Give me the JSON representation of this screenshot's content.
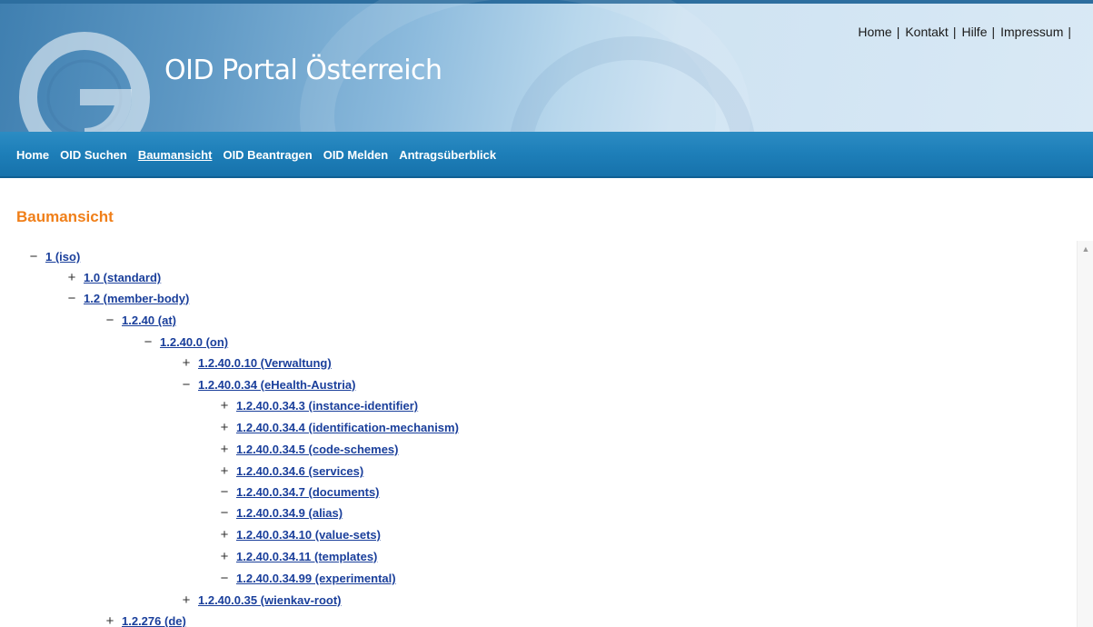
{
  "header": {
    "site_title": "OID Portal Österreich",
    "top_links": [
      {
        "label": "Home"
      },
      {
        "label": "Kontakt"
      },
      {
        "label": "Hilfe"
      },
      {
        "label": "Impressum"
      }
    ],
    "separator": "|"
  },
  "nav": {
    "items": [
      {
        "label": "Home",
        "active": false
      },
      {
        "label": "OID Suchen",
        "active": false
      },
      {
        "label": "Baumansicht",
        "active": true
      },
      {
        "label": "OID Beantragen",
        "active": false
      },
      {
        "label": "OID Melden",
        "active": false
      },
      {
        "label": "Antragsüberblick",
        "active": false
      }
    ]
  },
  "page": {
    "heading": "Baumansicht"
  },
  "tree": {
    "nodes": [
      {
        "toggle": "−",
        "label": "1 (iso)",
        "level": 0
      },
      {
        "toggle": "+",
        "label": "1.0 (standard)",
        "level": 1
      },
      {
        "toggle": "−",
        "label": "1.2 (member-body)",
        "level": 1
      },
      {
        "toggle": "−",
        "label": "1.2.40 (at)",
        "level": 2
      },
      {
        "toggle": "−",
        "label": "1.2.40.0 (on)",
        "level": 3
      },
      {
        "toggle": "+",
        "label": "1.2.40.0.10 (Verwaltung)",
        "level": 4
      },
      {
        "toggle": "−",
        "label": "1.2.40.0.34 (eHealth-Austria)",
        "level": 4
      },
      {
        "toggle": "+",
        "label": "1.2.40.0.34.3 (instance-identifier)",
        "level": 5
      },
      {
        "toggle": "+",
        "label": "1.2.40.0.34.4 (identification-mechanism)",
        "level": 5
      },
      {
        "toggle": "+",
        "label": "1.2.40.0.34.5 (code-schemes)",
        "level": 5
      },
      {
        "toggle": "+",
        "label": "1.2.40.0.34.6 (services)",
        "level": 5
      },
      {
        "toggle": "−",
        "label": "1.2.40.0.34.7 (documents)",
        "level": 5
      },
      {
        "toggle": "−",
        "label": "1.2.40.0.34.9 (alias)",
        "level": 5
      },
      {
        "toggle": "+",
        "label": "1.2.40.0.34.10 (value-sets)",
        "level": 5
      },
      {
        "toggle": "+",
        "label": "1.2.40.0.34.11 (templates)",
        "level": 5
      },
      {
        "toggle": "−",
        "label": "1.2.40.0.34.99 (experimental)",
        "level": 5
      },
      {
        "toggle": "+",
        "label": "1.2.40.0.35 (wienkav-root)",
        "level": 4
      },
      {
        "toggle": "+",
        "label": "1.2.276 (de)",
        "level": 2
      }
    ]
  },
  "scrollbar": {
    "up_arrow": "▲"
  },
  "colors": {
    "heading": "#f07f19",
    "link": "#1a3f9b",
    "nav_bg": "#1e7fb9"
  }
}
